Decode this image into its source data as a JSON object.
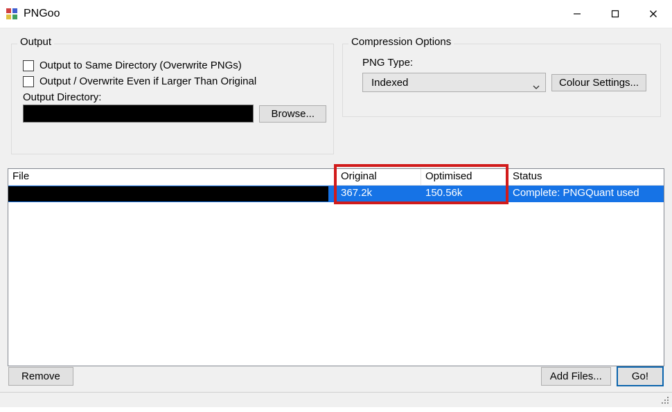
{
  "window": {
    "title": "PNGoo"
  },
  "output_group": {
    "legend": "Output",
    "cb_same_dir": "Output to Same Directory (Overwrite PNGs)",
    "cb_even_if_larger": "Output / Overwrite Even if Larger Than Original",
    "dir_label": "Output Directory:",
    "browse": "Browse..."
  },
  "compress_group": {
    "legend": "Compression Options",
    "png_type_label": "PNG Type:",
    "png_type_value": "Indexed",
    "colour_settings": "Colour Settings..."
  },
  "table": {
    "headers": {
      "file": "File",
      "original": "Original",
      "optimised": "Optimised",
      "status": "Status"
    },
    "rows": [
      {
        "file": "",
        "original": "367.2k",
        "optimised": "150.56k",
        "status": "Complete: PNGQuant used"
      }
    ]
  },
  "buttons": {
    "remove": "Remove",
    "add_files": "Add Files...",
    "go": "Go!"
  }
}
